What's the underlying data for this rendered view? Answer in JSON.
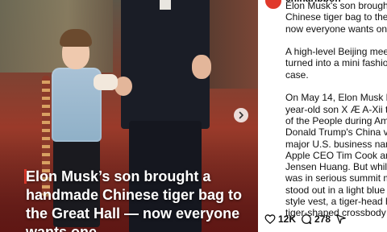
{
  "post": {
    "image": {
      "caption": "Elon Musk’s son brought a handmade Chinese tiger bag to the Great Hall — now everyone wants one"
    },
    "sidebar": {
      "handle": "chinaribbon",
      "text": "Elon Musk's son brought a ha\nChinese tiger bag to the Grea\nnow everyone wants one\n\nA high-level Beijing meeting s\nturned into a mini fashion def\ncase.\n\nOn May 14, Elon Musk broug\nyear-old son X Æ A-Xii to the\nof the People during America\nDonald Trump's China visit, a\nmajor U.S. business names in\nApple CEO Tim Cook and NV\nJensen Huang. But while eve\nwas in serious summit mode,\nstood out in a light blue New\nstyle vest, a tiger-head hat, a\ntiger-shaped crossbody bag.\n\nChinese netizens quickly trac"
    },
    "actions": {
      "likes": "12K",
      "comments": "278"
    }
  },
  "icons": {
    "carousel_next": "chevron-right-icon",
    "like": "heart-icon",
    "comment": "comment-icon",
    "share": "send-icon"
  }
}
